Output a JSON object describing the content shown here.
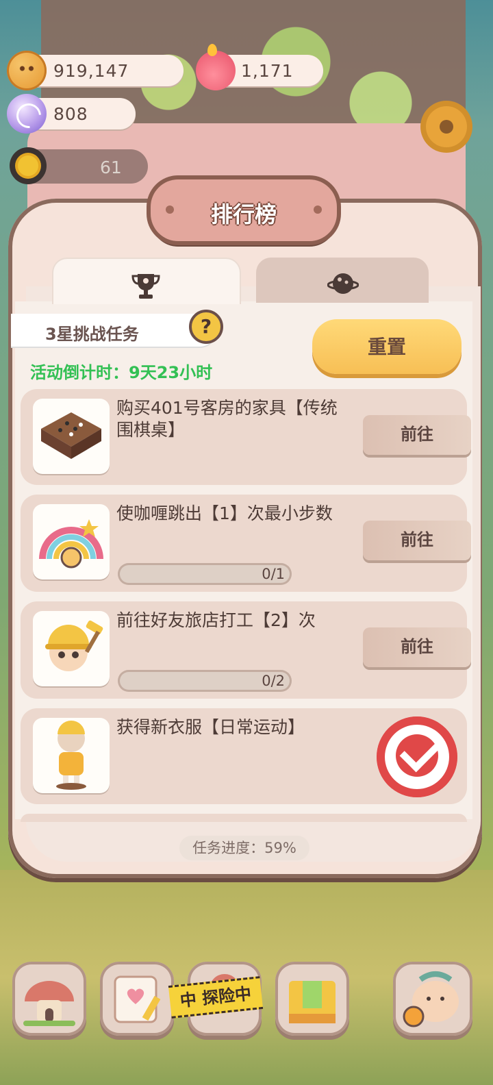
{
  "currency": {
    "cookies": "919,147",
    "candles": "1,171",
    "gems": "808",
    "level": "61"
  },
  "modal": {
    "title": "排行榜",
    "tabs": [
      {
        "icon": "trophy-icon"
      },
      {
        "icon": "planet-icon"
      }
    ],
    "task_header": "3星挑战任务",
    "help_label": "?",
    "countdown": "活动倒计时：9天23小时",
    "reset_label": "重置",
    "tasks": [
      {
        "text": "购买401号客房的家具【传统围棋桌】",
        "action": "前往",
        "icon": "go-board-icon"
      },
      {
        "text": "使咖喱跳出【1】次最小步数",
        "action": "前往",
        "progress": "0/1",
        "progress_value": 0,
        "icon": "rainbow-badge-icon"
      },
      {
        "text": "前往好友旅店打工【2】次",
        "action": "前往",
        "progress": "0/2",
        "progress_value": 0,
        "icon": "worker-icon"
      },
      {
        "text": "获得新衣服【日常运动】",
        "completed": true,
        "icon": "outfit-icon"
      }
    ],
    "progress_text": "任务进度：59%"
  },
  "bottom": {
    "explore_label": "中 探险中"
  },
  "colors": {
    "accent_green": "#33c054",
    "reset_button": "#f7bf55",
    "stamp_red": "#e04848"
  }
}
